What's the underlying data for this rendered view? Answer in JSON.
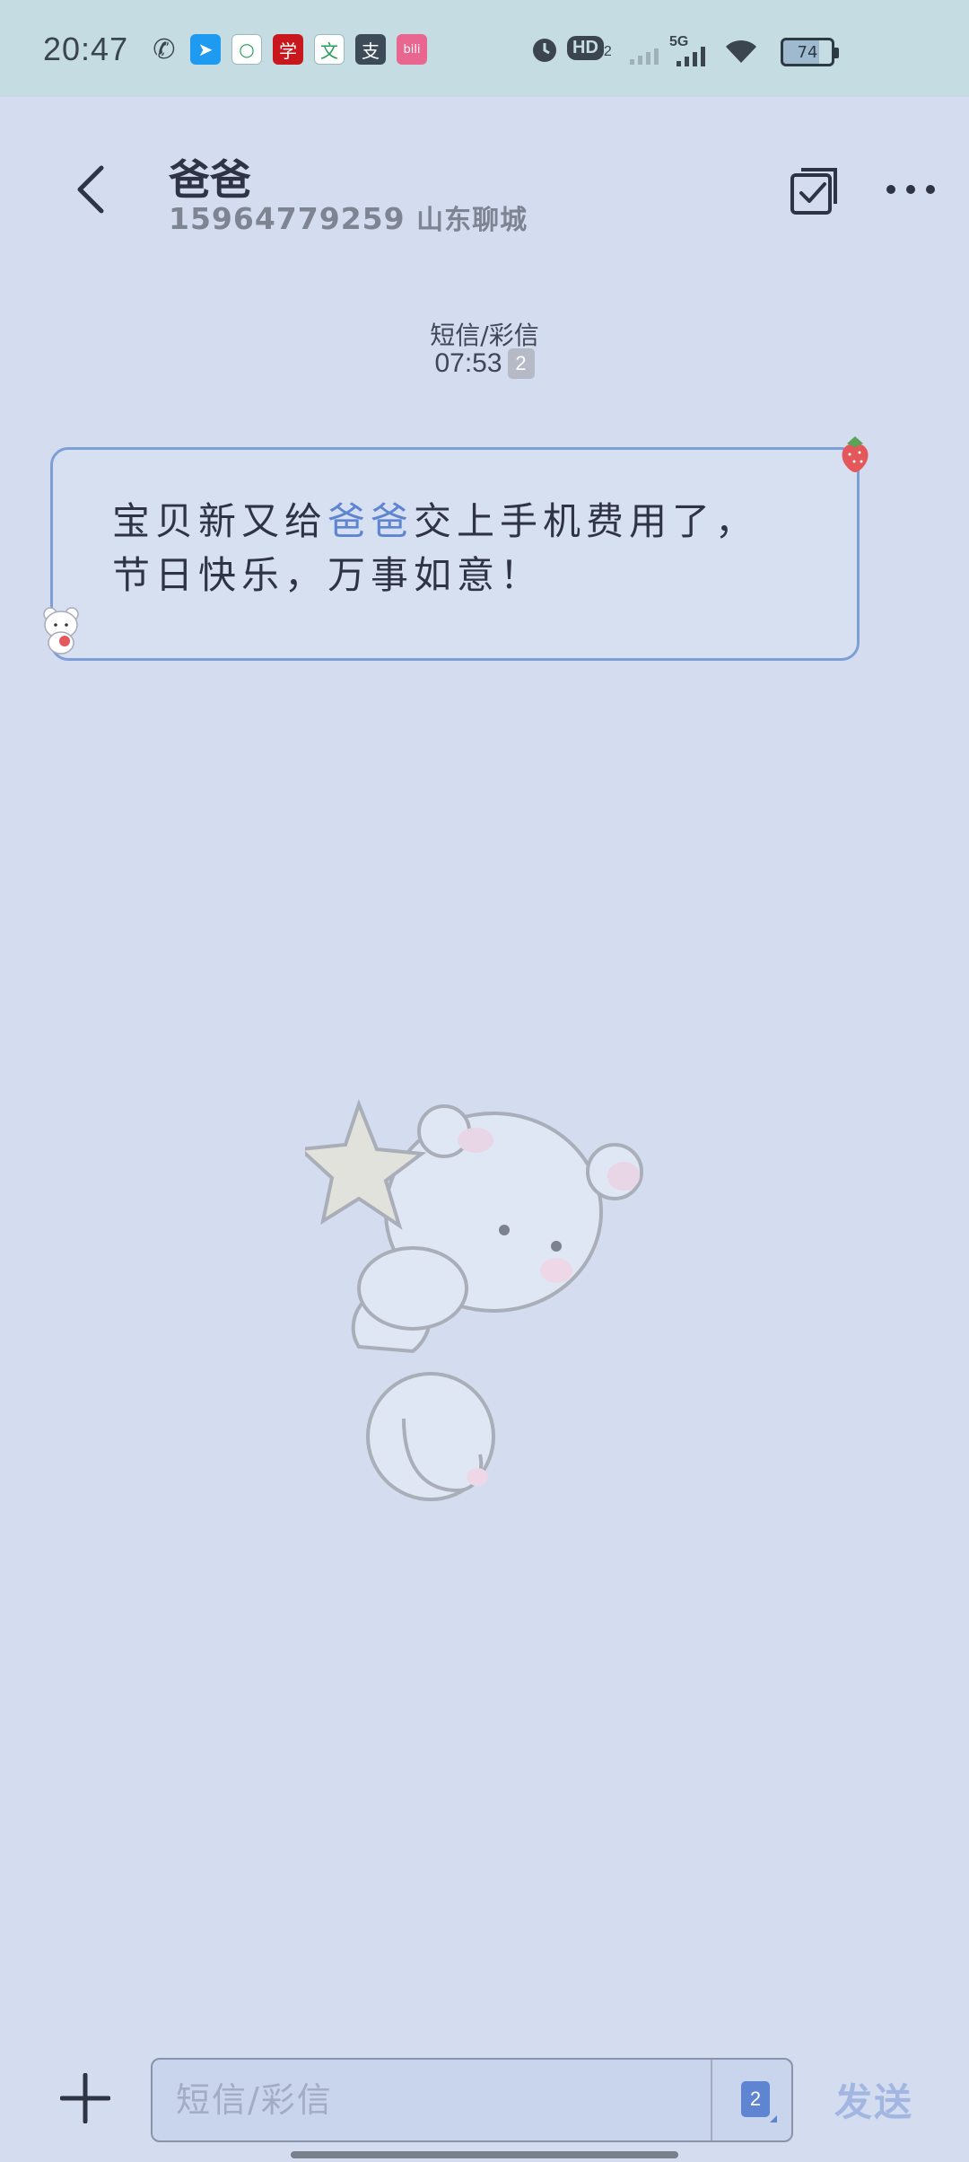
{
  "status_bar": {
    "time": "20:47",
    "network": "5G",
    "battery": "74",
    "hd_label": "HD",
    "app_icons": [
      {
        "name": "phone-icon",
        "glyph": "✆",
        "color": "transparent"
      },
      {
        "name": "feishu-app-icon",
        "glyph": "➤",
        "color": "#1e9af0"
      },
      {
        "name": "chat-bubble-app-icon",
        "glyph": "○",
        "color": "#ffffff"
      },
      {
        "name": "study-app-icon",
        "glyph": "学",
        "color": "#c8171d"
      },
      {
        "name": "wen-app-icon",
        "glyph": "文",
        "color": "#ffffff"
      },
      {
        "name": "alipay-app-icon",
        "glyph": "支",
        "color": "#3d4a58"
      },
      {
        "name": "bilibili-app-icon",
        "glyph": "bili",
        "color": "#e8668f"
      }
    ]
  },
  "header": {
    "contact_name": "爸爸",
    "contact_number": "15964779259",
    "contact_location": "山东聊城"
  },
  "conversation": {
    "message_type": "短信/彩信",
    "time": "07:53",
    "sim": "2",
    "message": {
      "before": "宝贝新又给",
      "link": "爸爸",
      "after": "交上手机费用了，节日快乐，万事如意！"
    }
  },
  "input": {
    "placeholder": "短信/彩信",
    "sim": "2",
    "send_label": "发送"
  },
  "colors": {
    "background": "#d3ddef",
    "status_bar": "#c5dde2",
    "bubble_border": "#7e9fd6",
    "accent": "#5f85d2"
  }
}
